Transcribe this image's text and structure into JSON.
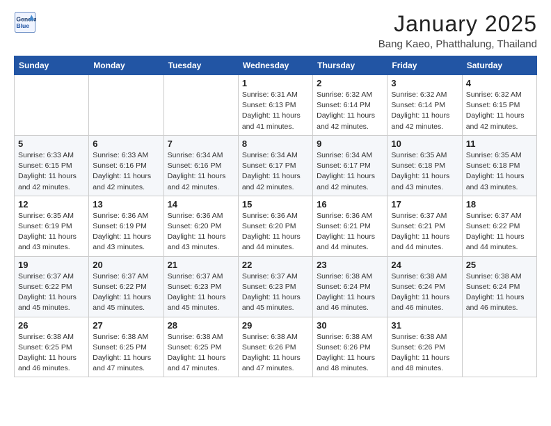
{
  "header": {
    "logo_line1": "General",
    "logo_line2": "Blue",
    "month": "January 2025",
    "location": "Bang Kaeo, Phatthalung, Thailand"
  },
  "days_of_week": [
    "Sunday",
    "Monday",
    "Tuesday",
    "Wednesday",
    "Thursday",
    "Friday",
    "Saturday"
  ],
  "weeks": [
    [
      {
        "day": "",
        "info": ""
      },
      {
        "day": "",
        "info": ""
      },
      {
        "day": "",
        "info": ""
      },
      {
        "day": "1",
        "info": "Sunrise: 6:31 AM\nSunset: 6:13 PM\nDaylight: 11 hours\nand 41 minutes."
      },
      {
        "day": "2",
        "info": "Sunrise: 6:32 AM\nSunset: 6:14 PM\nDaylight: 11 hours\nand 42 minutes."
      },
      {
        "day": "3",
        "info": "Sunrise: 6:32 AM\nSunset: 6:14 PM\nDaylight: 11 hours\nand 42 minutes."
      },
      {
        "day": "4",
        "info": "Sunrise: 6:32 AM\nSunset: 6:15 PM\nDaylight: 11 hours\nand 42 minutes."
      }
    ],
    [
      {
        "day": "5",
        "info": "Sunrise: 6:33 AM\nSunset: 6:15 PM\nDaylight: 11 hours\nand 42 minutes."
      },
      {
        "day": "6",
        "info": "Sunrise: 6:33 AM\nSunset: 6:16 PM\nDaylight: 11 hours\nand 42 minutes."
      },
      {
        "day": "7",
        "info": "Sunrise: 6:34 AM\nSunset: 6:16 PM\nDaylight: 11 hours\nand 42 minutes."
      },
      {
        "day": "8",
        "info": "Sunrise: 6:34 AM\nSunset: 6:17 PM\nDaylight: 11 hours\nand 42 minutes."
      },
      {
        "day": "9",
        "info": "Sunrise: 6:34 AM\nSunset: 6:17 PM\nDaylight: 11 hours\nand 42 minutes."
      },
      {
        "day": "10",
        "info": "Sunrise: 6:35 AM\nSunset: 6:18 PM\nDaylight: 11 hours\nand 43 minutes."
      },
      {
        "day": "11",
        "info": "Sunrise: 6:35 AM\nSunset: 6:18 PM\nDaylight: 11 hours\nand 43 minutes."
      }
    ],
    [
      {
        "day": "12",
        "info": "Sunrise: 6:35 AM\nSunset: 6:19 PM\nDaylight: 11 hours\nand 43 minutes."
      },
      {
        "day": "13",
        "info": "Sunrise: 6:36 AM\nSunset: 6:19 PM\nDaylight: 11 hours\nand 43 minutes."
      },
      {
        "day": "14",
        "info": "Sunrise: 6:36 AM\nSunset: 6:20 PM\nDaylight: 11 hours\nand 43 minutes."
      },
      {
        "day": "15",
        "info": "Sunrise: 6:36 AM\nSunset: 6:20 PM\nDaylight: 11 hours\nand 44 minutes."
      },
      {
        "day": "16",
        "info": "Sunrise: 6:36 AM\nSunset: 6:21 PM\nDaylight: 11 hours\nand 44 minutes."
      },
      {
        "day": "17",
        "info": "Sunrise: 6:37 AM\nSunset: 6:21 PM\nDaylight: 11 hours\nand 44 minutes."
      },
      {
        "day": "18",
        "info": "Sunrise: 6:37 AM\nSunset: 6:22 PM\nDaylight: 11 hours\nand 44 minutes."
      }
    ],
    [
      {
        "day": "19",
        "info": "Sunrise: 6:37 AM\nSunset: 6:22 PM\nDaylight: 11 hours\nand 45 minutes."
      },
      {
        "day": "20",
        "info": "Sunrise: 6:37 AM\nSunset: 6:22 PM\nDaylight: 11 hours\nand 45 minutes."
      },
      {
        "day": "21",
        "info": "Sunrise: 6:37 AM\nSunset: 6:23 PM\nDaylight: 11 hours\nand 45 minutes."
      },
      {
        "day": "22",
        "info": "Sunrise: 6:37 AM\nSunset: 6:23 PM\nDaylight: 11 hours\nand 45 minutes."
      },
      {
        "day": "23",
        "info": "Sunrise: 6:38 AM\nSunset: 6:24 PM\nDaylight: 11 hours\nand 46 minutes."
      },
      {
        "day": "24",
        "info": "Sunrise: 6:38 AM\nSunset: 6:24 PM\nDaylight: 11 hours\nand 46 minutes."
      },
      {
        "day": "25",
        "info": "Sunrise: 6:38 AM\nSunset: 6:24 PM\nDaylight: 11 hours\nand 46 minutes."
      }
    ],
    [
      {
        "day": "26",
        "info": "Sunrise: 6:38 AM\nSunset: 6:25 PM\nDaylight: 11 hours\nand 46 minutes."
      },
      {
        "day": "27",
        "info": "Sunrise: 6:38 AM\nSunset: 6:25 PM\nDaylight: 11 hours\nand 47 minutes."
      },
      {
        "day": "28",
        "info": "Sunrise: 6:38 AM\nSunset: 6:25 PM\nDaylight: 11 hours\nand 47 minutes."
      },
      {
        "day": "29",
        "info": "Sunrise: 6:38 AM\nSunset: 6:26 PM\nDaylight: 11 hours\nand 47 minutes."
      },
      {
        "day": "30",
        "info": "Sunrise: 6:38 AM\nSunset: 6:26 PM\nDaylight: 11 hours\nand 48 minutes."
      },
      {
        "day": "31",
        "info": "Sunrise: 6:38 AM\nSunset: 6:26 PM\nDaylight: 11 hours\nand 48 minutes."
      },
      {
        "day": "",
        "info": ""
      }
    ]
  ]
}
